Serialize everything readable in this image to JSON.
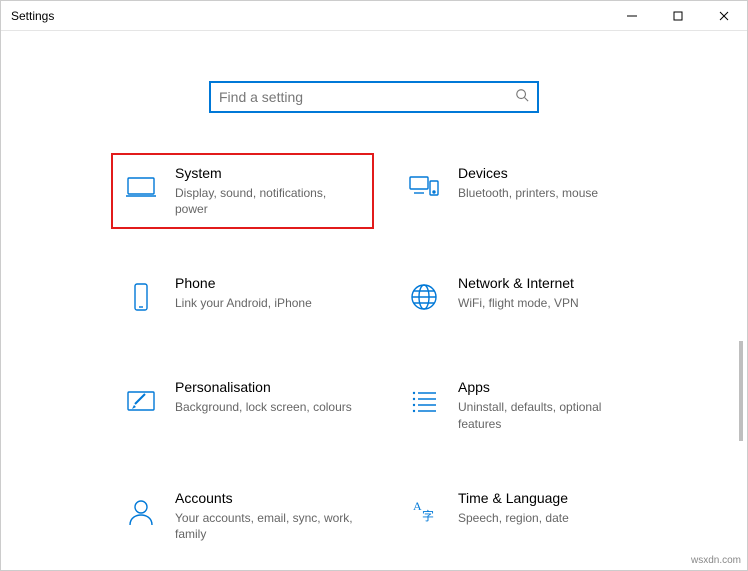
{
  "window": {
    "title": "Settings"
  },
  "search": {
    "placeholder": "Find a setting"
  },
  "tiles": {
    "system": {
      "title": "System",
      "sub": "Display, sound, notifications, power"
    },
    "devices": {
      "title": "Devices",
      "sub": "Bluetooth, printers, mouse"
    },
    "phone": {
      "title": "Phone",
      "sub": "Link your Android, iPhone"
    },
    "network": {
      "title": "Network & Internet",
      "sub": "WiFi, flight mode, VPN"
    },
    "personalisation": {
      "title": "Personalisation",
      "sub": "Background, lock screen, colours"
    },
    "apps": {
      "title": "Apps",
      "sub": "Uninstall, defaults, optional features"
    },
    "accounts": {
      "title": "Accounts",
      "sub": "Your accounts, email, sync, work, family"
    },
    "time": {
      "title": "Time & Language",
      "sub": "Speech, region, date"
    }
  },
  "watermark": "wsxdn.com"
}
